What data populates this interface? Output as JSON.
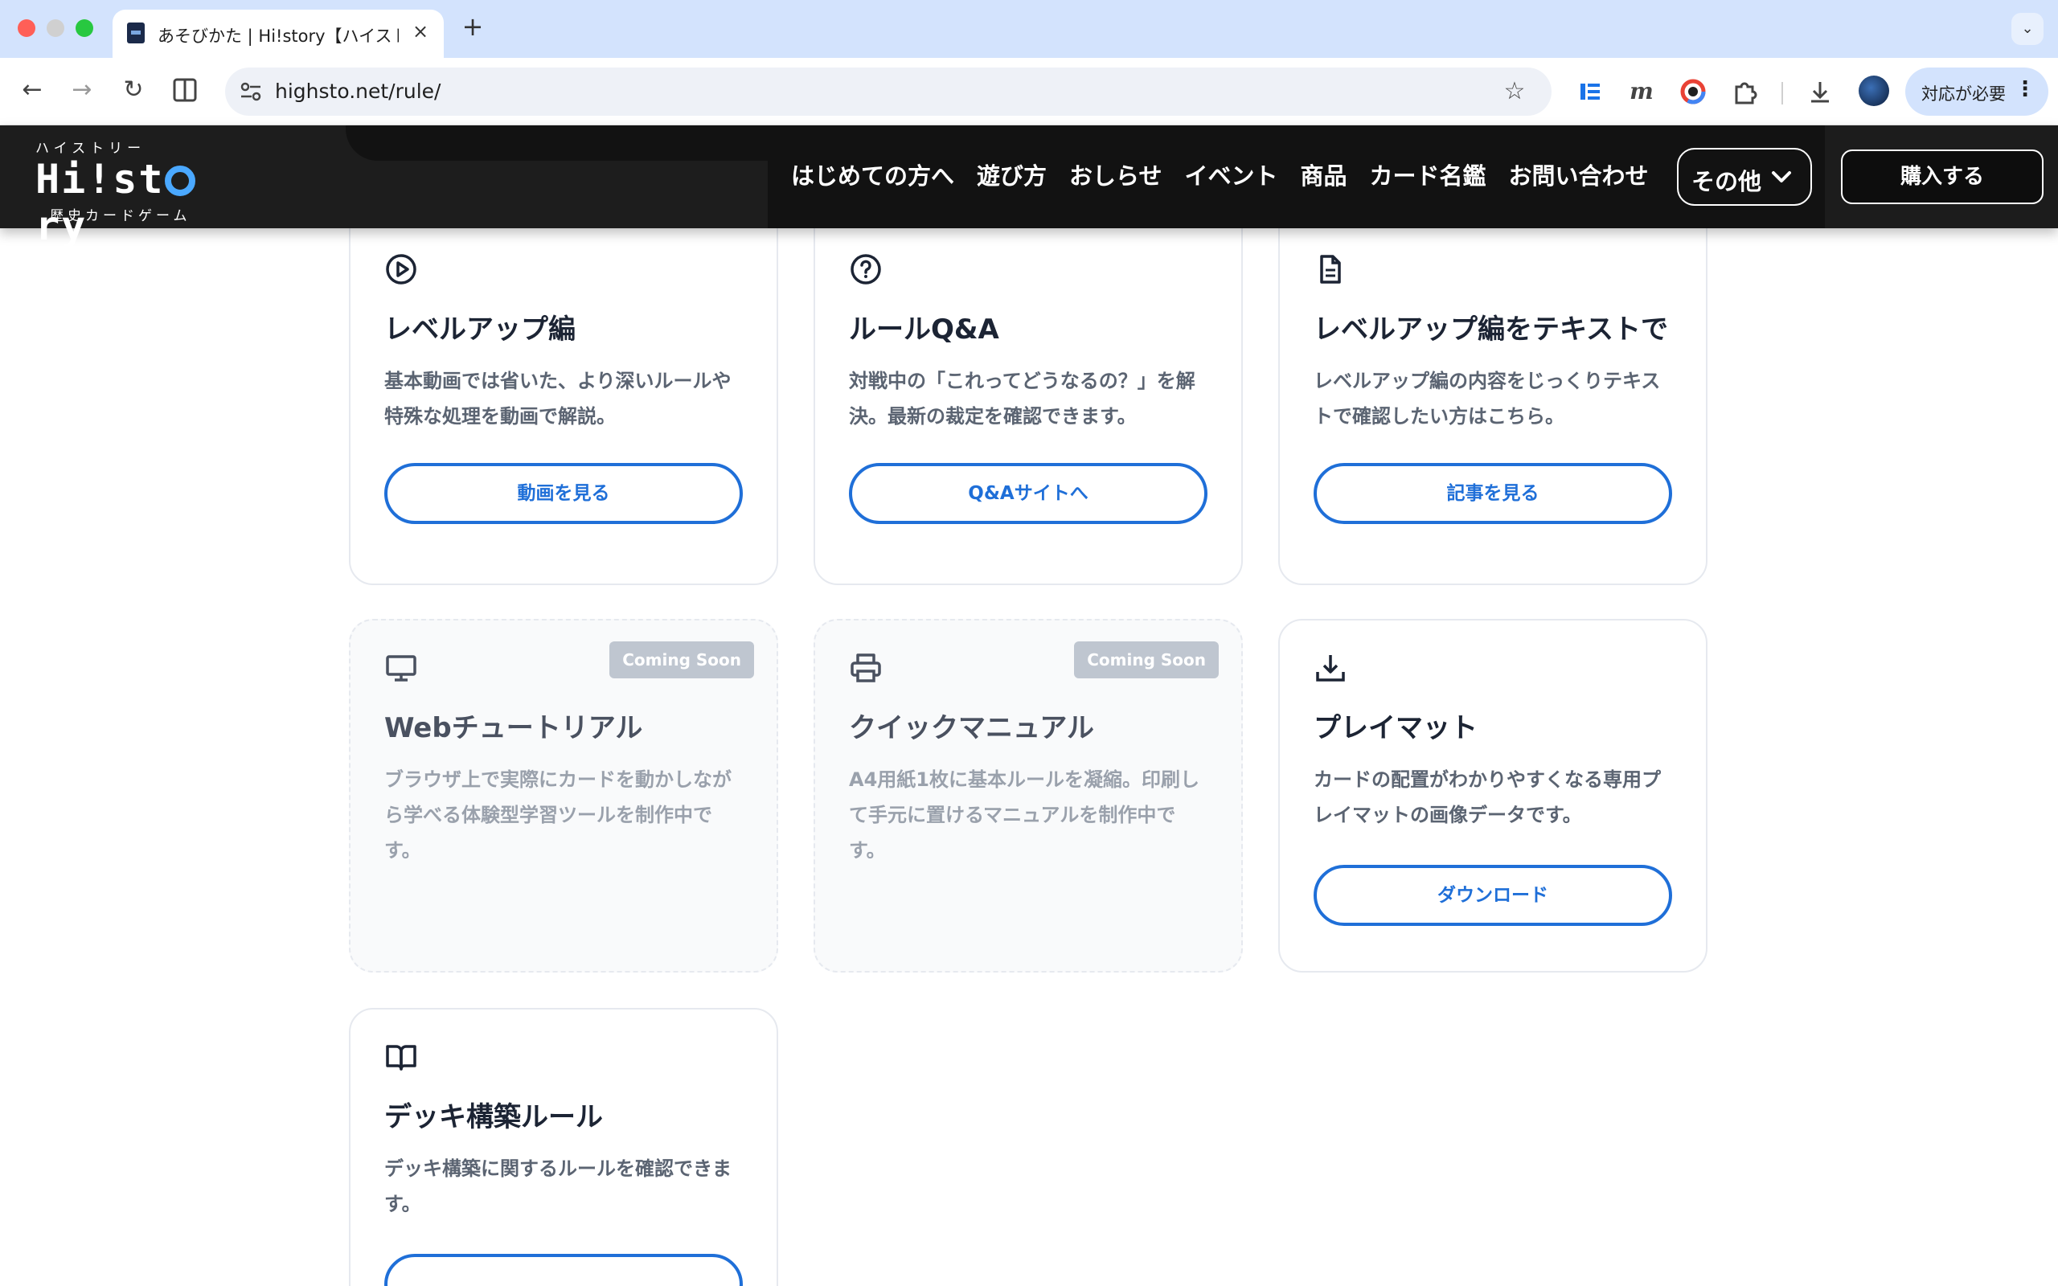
{
  "browser": {
    "tab_title": "あそびかた | Hi!story【ハイストリー】",
    "tab_close": "×",
    "new_tab": "+",
    "tab_menu": "⌄",
    "url": "highsto.net/rule/",
    "action_label": "対応が必要",
    "action_more": "⋮",
    "icons": [
      "back-icon",
      "forward-icon",
      "reload-icon",
      "split-view-icon",
      "site-info-icon",
      "star-icon",
      "reader-icon",
      "extension-m-icon",
      "color-picker-icon",
      "extensions-icon",
      "download-icon",
      "profile-avatar-icon",
      "more-icon"
    ]
  },
  "header": {
    "logo_kana": "ハイストリー",
    "logo_word_before": "Hi!st",
    "logo_word_after": "ry",
    "logo_sub": "歴史カードゲーム",
    "nav": [
      "はじめての方へ",
      "遊び方",
      "おしらせ",
      "イベント",
      "商品",
      "カード名鑑",
      "お問い合わせ"
    ],
    "more_label": "その他",
    "buy_label": "購入する"
  },
  "cards": [
    {
      "icon": "play-circle-icon",
      "title": "レベルアップ編",
      "desc": "基本動画では省いた、より深いルールや特殊な処理を動画で解説。",
      "button": "動画を見る"
    },
    {
      "icon": "help-circle-icon",
      "title": "ルールQ&A",
      "desc": "対戦中の「これってどうなるの？」を解決。最新の裁定を確認できます。",
      "button": "Q&Aサイトへ"
    },
    {
      "icon": "document-icon",
      "title": "レベルアップ編をテキストで",
      "desc": "レベルアップ編の内容をじっくりテキストで確認したい方はこちら。",
      "button": "記事を見る"
    },
    {
      "icon": "monitor-icon",
      "title": "Webチュートリアル",
      "desc": "ブラウザ上で実際にカードを動かしながら学べる体験型学習ツールを制作中です。",
      "badge": "Coming Soon"
    },
    {
      "icon": "printer-icon",
      "title": "クイックマニュアル",
      "desc": "A4用紙1枚に基本ルールを凝縮。印刷して手元に置けるマニュアルを制作中です。",
      "badge": "Coming Soon"
    },
    {
      "icon": "download-icon",
      "title": "プレイマット",
      "desc": "カードの配置がわかりやすくなる専用プレイマットの画像データです。",
      "button": "ダウンロード"
    },
    {
      "icon": "book-open-icon",
      "title": "デッキ構築ルール",
      "desc": "デッキ構築に関するルールを確認できます。"
    }
  ],
  "colors": {
    "accent": "#1f6fd8",
    "header_bg": "#121212",
    "chrome_bg": "#d3e3fd",
    "badge_bg": "#bfc6d0"
  }
}
